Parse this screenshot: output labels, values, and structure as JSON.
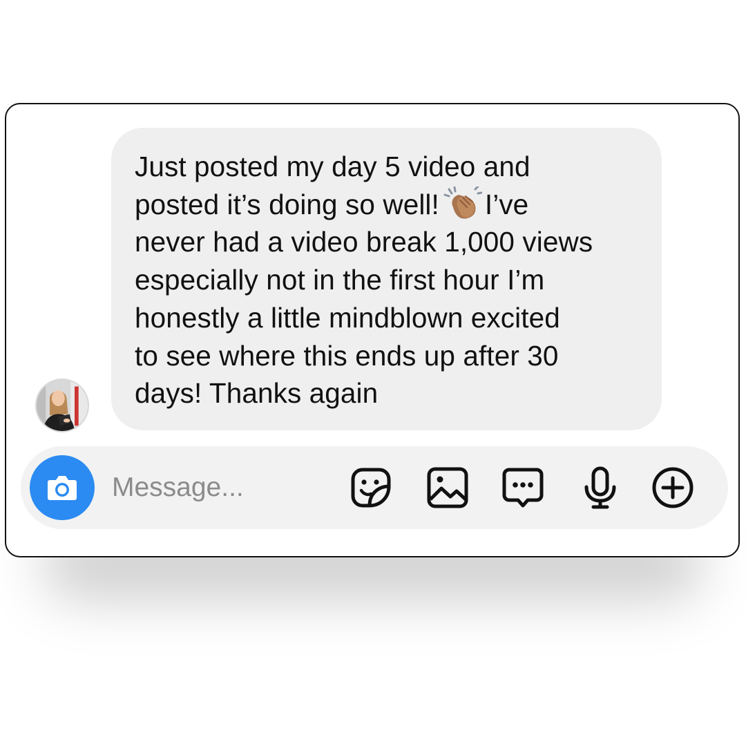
{
  "chat": {
    "message": {
      "lines": [
        "Just posted my day 5 video and",
        "posted it’s doing so well!",
        "I’ve",
        "never had a video break 1,000 views",
        "especially not in the first hour I’m",
        "honestly a little mindblown excited",
        "to see where this ends up after 30",
        "days! Thanks again"
      ],
      "emoji": "clapping-hands-emoji"
    },
    "avatar": "user-avatar"
  },
  "composer": {
    "placeholder": "Message...",
    "value": "",
    "icons": {
      "camera": "camera-icon",
      "sticker": "sticker-icon",
      "gallery": "gallery-icon",
      "quick_reply": "chat-bubble-icon",
      "voice": "microphone-icon",
      "more": "plus-circle-icon"
    }
  },
  "colors": {
    "accent_blue": "#2b8bf2",
    "bubble_bg": "#efefef",
    "composer_bg": "#f2f2f2",
    "text": "#111111",
    "placeholder": "#8b8b8b"
  }
}
